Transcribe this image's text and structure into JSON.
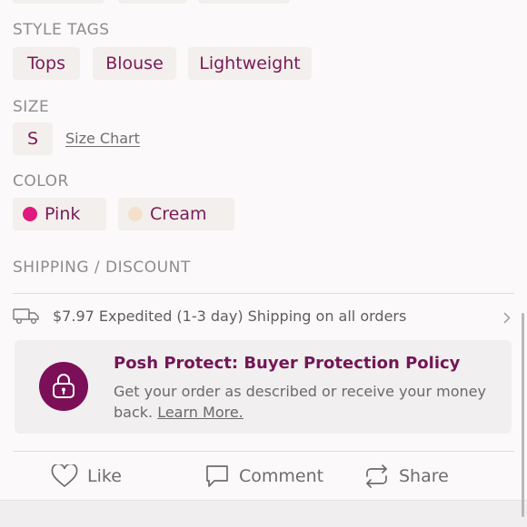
{
  "style_tags": {
    "label": "STYLE TAGS",
    "tags": [
      "Tops",
      "Blouse",
      "Lightweight"
    ]
  },
  "size": {
    "label": "SIZE",
    "value": "S",
    "size_chart_link": "Size Chart"
  },
  "color": {
    "label": "COLOR",
    "options": [
      {
        "name": "Pink",
        "swatch": "#e0197f"
      },
      {
        "name": "Cream",
        "swatch": "#f3e1cc"
      }
    ]
  },
  "shipping": {
    "label": "SHIPPING / DISCOUNT",
    "text": "$7.97 Expedited (1-3 day) Shipping on all orders",
    "icon": "truck-icon"
  },
  "posh_protect": {
    "title": "Posh Protect: Buyer Protection Policy",
    "body": "Get your order as described or receive your money back.",
    "link": "Learn More.",
    "icon": "lock-icon",
    "badge_color": "#7b0f58"
  },
  "actions": {
    "like": "Like",
    "comment": "Comment",
    "share": "Share"
  },
  "colors": {
    "accent": "#7a1a58",
    "chip_bg": "#f3efec"
  }
}
